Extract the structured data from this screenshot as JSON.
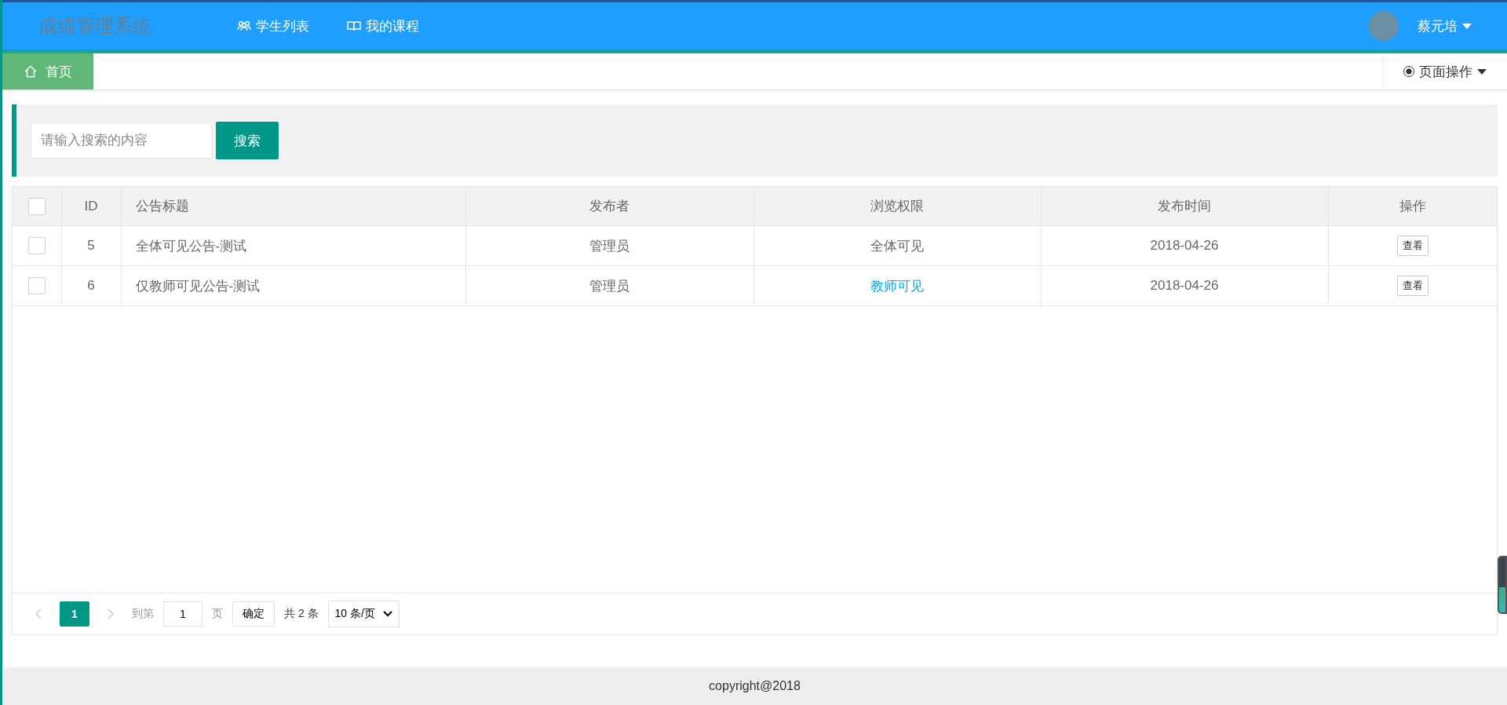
{
  "header": {
    "logo": "成绩管理系统",
    "nav": [
      {
        "label": "学生列表"
      },
      {
        "label": "我的课程"
      }
    ],
    "user": {
      "name": "蔡元培"
    }
  },
  "tabs": [
    {
      "label": "首页",
      "selected": true
    }
  ],
  "page_actions": {
    "label": "页面操作"
  },
  "search": {
    "placeholder": "请输入搜索的内容",
    "button": "搜索"
  },
  "table": {
    "header_checked": false,
    "columns": [
      "ID",
      "公告标题",
      "发布者",
      "浏览权限",
      "发布时间",
      "操作"
    ],
    "rows": [
      {
        "checked": false,
        "id": "5",
        "title": "全体可见公告-测试",
        "publisher": "管理员",
        "permission": {
          "text": "全体可见",
          "color": "#666666"
        },
        "date": "2018-04-26",
        "action": "查看"
      },
      {
        "checked": false,
        "id": "6",
        "title": "仅教师可见公告-测试",
        "publisher": "管理员",
        "permission": {
          "text": "教师可见",
          "color": "#01aaed"
        },
        "date": "2018-04-26",
        "action": "查看"
      }
    ]
  },
  "pagination": {
    "pages": [
      {
        "label": "1",
        "selected": true
      }
    ],
    "goto_label": "到第",
    "goto_value": "1",
    "page_unit": "页",
    "confirm": "确定",
    "total": "共 2 条",
    "page_size": "10 条/页"
  },
  "footer": {
    "copyright": "copyright@2018"
  }
}
